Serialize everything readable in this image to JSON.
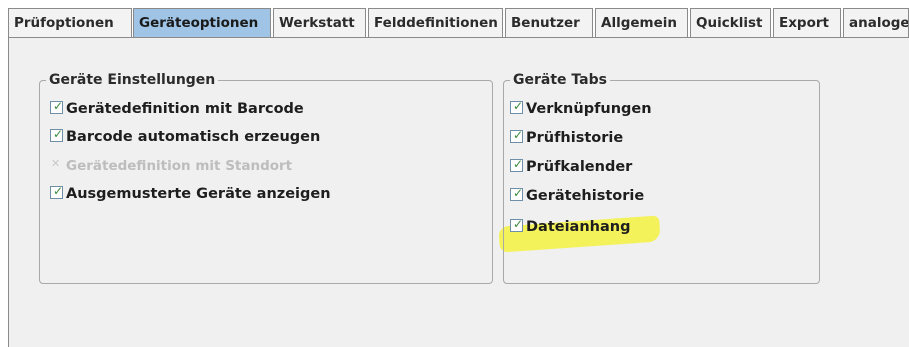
{
  "tabs": [
    {
      "label": "Prüfoptionen",
      "active": false
    },
    {
      "label": "Geräteoptionen",
      "active": true
    },
    {
      "label": "Werkstatt",
      "active": false
    },
    {
      "label": "Felddefinitionen",
      "active": false
    },
    {
      "label": "Benutzer",
      "active": false
    },
    {
      "label": "Allgemein",
      "active": false
    },
    {
      "label": "Quicklist",
      "active": false
    },
    {
      "label": "Export",
      "active": false
    },
    {
      "label": "analoge",
      "active": false
    }
  ],
  "group_settings": {
    "title": "Geräte Einstellungen",
    "options": [
      {
        "label": "Gerätedefinition mit Barcode",
        "checked": true,
        "enabled": true
      },
      {
        "label": "Barcode automatisch erzeugen",
        "checked": true,
        "enabled": true
      },
      {
        "label": "Gerätedefinition mit Standort",
        "checked": true,
        "enabled": false
      },
      {
        "label": "Ausgemusterte Geräte anzeigen",
        "checked": true,
        "enabled": true
      }
    ]
  },
  "group_tabs": {
    "title": "Geräte Tabs",
    "options": [
      {
        "label": "Verknüpfungen",
        "checked": true
      },
      {
        "label": "Prüfhistorie",
        "checked": true
      },
      {
        "label": "Prüfkalender",
        "checked": true
      },
      {
        "label": "Gerätehistorie",
        "checked": true
      },
      {
        "label": "Dateianhang",
        "checked": true,
        "highlighted": true
      }
    ]
  },
  "colors": {
    "active_tab": "#9fc4e6",
    "highlight": "#f4f25a",
    "check_mark": "#3a8a3a"
  },
  "icons": {
    "check": "check-icon"
  }
}
